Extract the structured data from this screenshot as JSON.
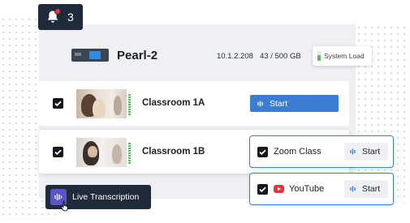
{
  "notifications": {
    "count": "3"
  },
  "device": {
    "name": "Pearl-2",
    "ip": "10.1.2.208",
    "storage": "43 / 500 GB",
    "system_load_label": "System Load",
    "system_load_level": 0.55
  },
  "channels": [
    {
      "label": "Classroom 1A",
      "checked": true,
      "start_label": "Start"
    },
    {
      "label": "Classroom 1B",
      "checked": true
    }
  ],
  "destinations": [
    {
      "label": "Zoom Class",
      "checked": true,
      "start_label": "Start"
    },
    {
      "label": "YouTube",
      "checked": true,
      "start_label": "Start"
    }
  ],
  "transcription": {
    "label": "Live Transcription"
  },
  "colors": {
    "accent": "#3a7dd1",
    "dark": "#1f2a3a",
    "notification_dot": "#e5363e",
    "meter": "#5cb85c",
    "transcription_icon": "#5c55c7"
  }
}
